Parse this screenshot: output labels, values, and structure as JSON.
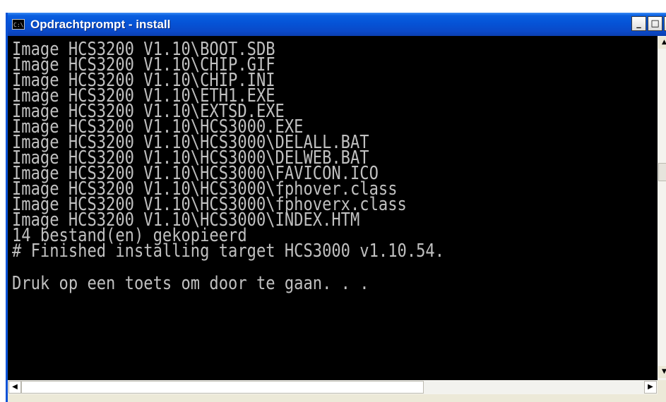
{
  "window": {
    "title": "Opdrachtprompt - install",
    "icon": "console-icon",
    "icon_text": "C:\\",
    "buttons": {
      "minimize": "_",
      "maximize": "□",
      "close": "×"
    }
  },
  "console": {
    "lines": [
      "Image HCS3200 V1.10\\BOOT.SDB",
      "Image HCS3200 V1.10\\CHIP.GIF",
      "Image HCS3200 V1.10\\CHIP.INI",
      "Image HCS3200 V1.10\\ETH1.EXE",
      "Image HCS3200 V1.10\\EXTSD.EXE",
      "Image HCS3200 V1.10\\HCS3000.EXE",
      "Image HCS3200 V1.10\\HCS3000\\DELALL.BAT",
      "Image HCS3200 V1.10\\HCS3000\\DELWEB.BAT",
      "Image HCS3200 V1.10\\HCS3000\\FAVICON.ICO",
      "Image HCS3200 V1.10\\HCS3000\\fphover.class",
      "Image HCS3200 V1.10\\HCS3000\\fphoverx.class",
      "Image HCS3200 V1.10\\HCS3000\\INDEX.HTM",
      "14 bestand(en) gekopieerd",
      "# Finished installing target HCS3000 v1.10.54.",
      "",
      "Druk op een toets om door te gaan. . ."
    ]
  },
  "scrollbars": {
    "up_arrow": "▲",
    "down_arrow": "▼",
    "left_arrow": "◀",
    "right_arrow": "▶"
  },
  "colors": {
    "titlebar": "#0553d6",
    "console_bg": "#000000",
    "console_text": "#c0c0c0"
  }
}
